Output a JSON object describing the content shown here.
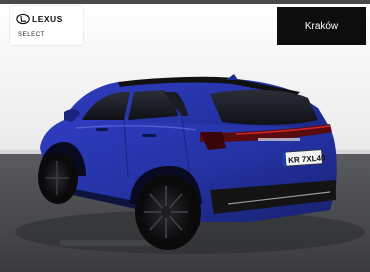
{
  "brand": {
    "logo_text": "LEXUS",
    "tagline": "SELECT"
  },
  "location": {
    "label": "Kraków"
  },
  "vehicle": {
    "plate": "KR 7XL40",
    "body_color": "#2a35a8"
  },
  "colors": {
    "badge_bg": "#0d0d0d",
    "wall": "#f1f1f1",
    "floor": "#4a4b4e"
  }
}
